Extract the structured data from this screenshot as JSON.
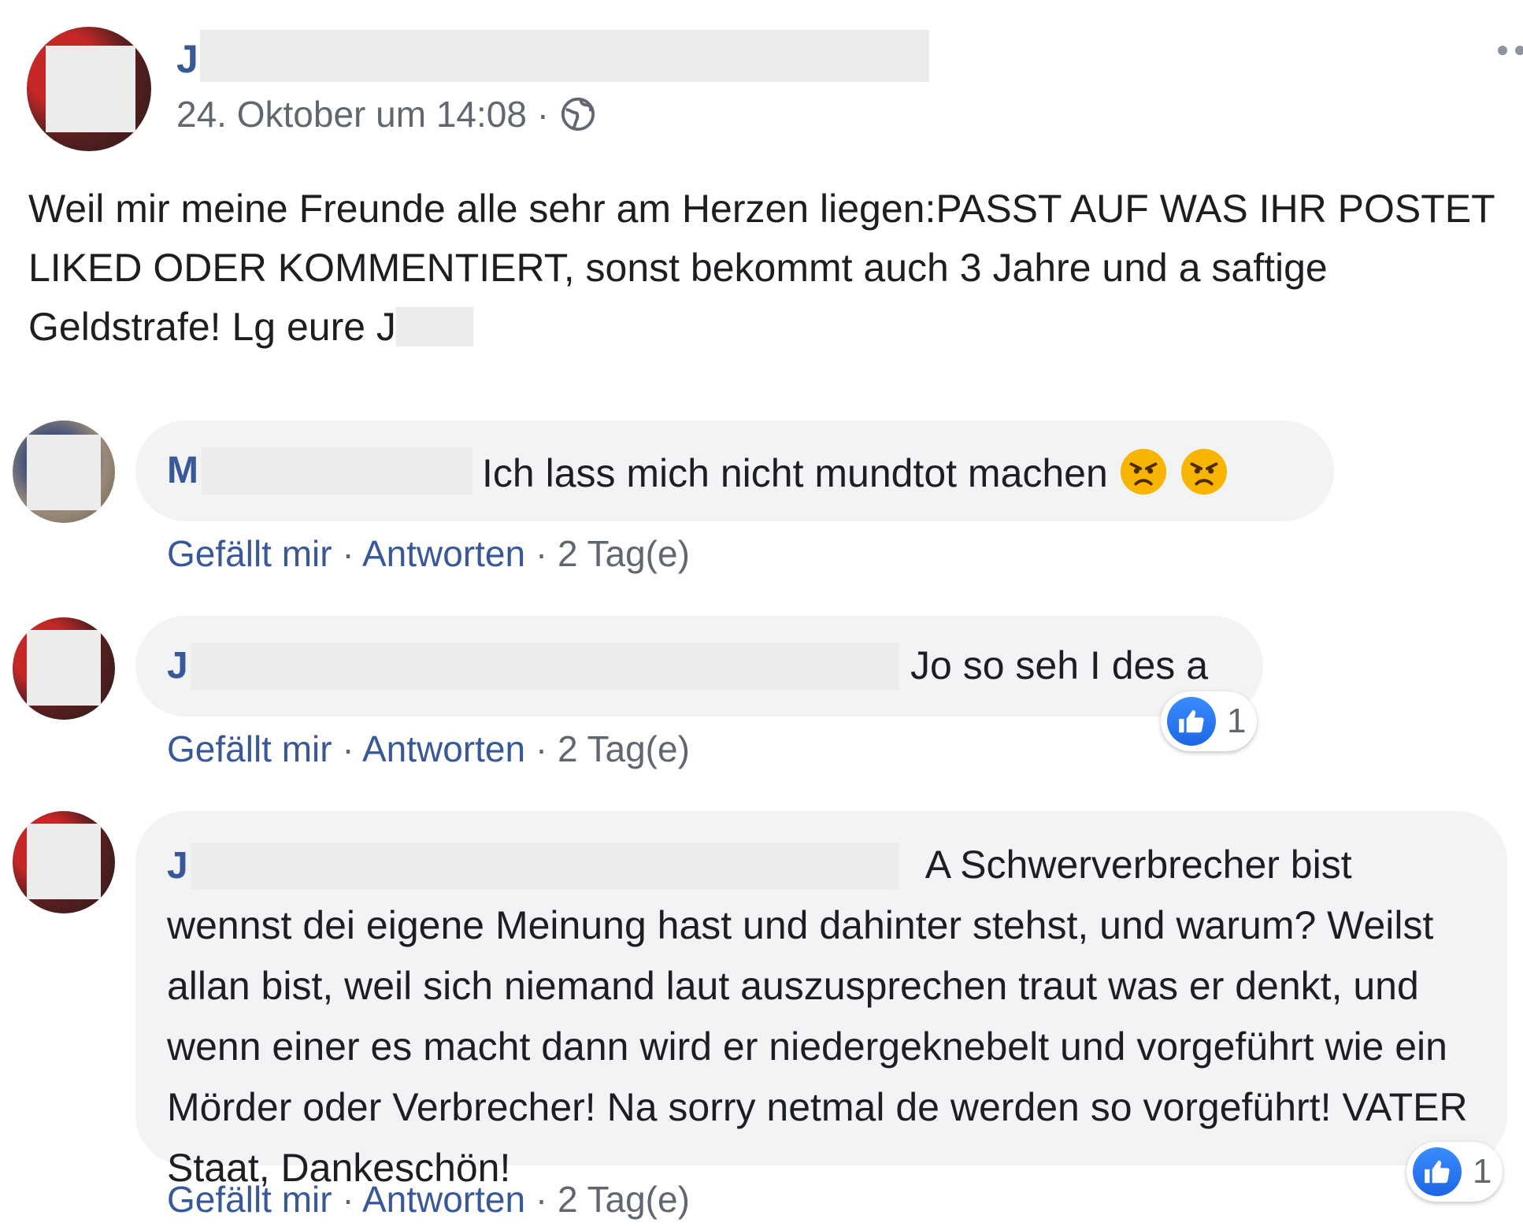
{
  "post": {
    "author_initial": "J",
    "timestamp": "24. Oktober um 14:08 ·",
    "text_before_redact": "Weil mir meine Freunde alle sehr am Herzen liegen:PASST AUF WAS IHR POSTET LIKED ODER KOMMENTIERT, sonst bekommt auch 3 Jahre und a saftige Geldstrafe! Lg eure J",
    "privacy_icon": "globe-icon",
    "menu_icon": "more-options-icon"
  },
  "comments": [
    {
      "author_initial": "M",
      "text": "Ich lass mich nicht mundtot machen",
      "emojis": [
        "angry-face-icon",
        "angry-face-icon"
      ],
      "like_label": "Gefällt mir",
      "reply_label": "Antworten",
      "sep": "·",
      "age": "2 Tag(e)"
    },
    {
      "author_initial": "J",
      "text": "Jo so seh I des a",
      "reaction_count": "1",
      "like_label": "Gefällt mir",
      "reply_label": "Antworten",
      "sep": "·",
      "age": "2 Tag(e)"
    },
    {
      "author_initial": "J",
      "text_first_line": "A Schwerverbrecher bist",
      "text_rest": "wennst dei eigene Meinung hast und dahinter stehst, und warum? Weilst allan bist, weil sich niemand laut auszusprechen traut was er denkt, und wenn einer es macht dann wird er niedergeknebelt und vorgeführt wie ein Mörder oder Verbrecher! Na sorry netmal de werden so vorgeführt! VATER Staat, Dankeschön!",
      "reaction_count": "1",
      "like_label": "Gefällt mir",
      "reply_label": "Antworten",
      "sep": "·",
      "age": "2 Tag(e)"
    }
  ],
  "colors": {
    "link": "#385898",
    "meta": "#616770",
    "bubble": "#f2f3f5",
    "like_blue": "#1d66e5"
  }
}
